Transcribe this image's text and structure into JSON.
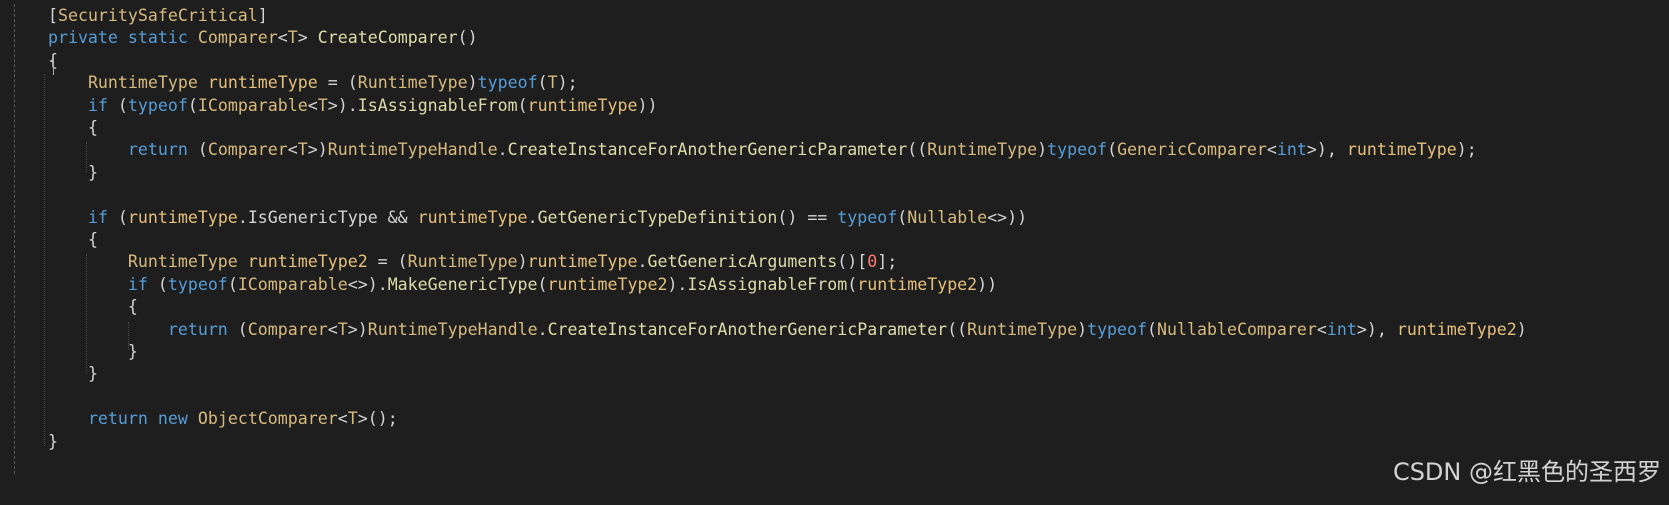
{
  "colors": {
    "background": "#1e1e1e",
    "default": "#d4d4d4",
    "keyword": "#569cd6",
    "type": "#d7ba7d",
    "method": "#dcdcaa",
    "variable": "#e6c07b",
    "number": "#ff7b72",
    "bracket": "#d4d4d4"
  },
  "code": {
    "lines": [
      [
        {
          "t": "    ",
          "c": "default"
        },
        {
          "t": "[",
          "c": "default"
        },
        {
          "t": "SecuritySafeCritical",
          "c": "type"
        },
        {
          "t": "]",
          "c": "default"
        }
      ],
      [
        {
          "t": "    ",
          "c": "default"
        },
        {
          "t": "private",
          "c": "keyword"
        },
        {
          "t": " ",
          "c": "default"
        },
        {
          "t": "static",
          "c": "keyword"
        },
        {
          "t": " ",
          "c": "default"
        },
        {
          "t": "Comparer",
          "c": "type"
        },
        {
          "t": "<",
          "c": "default"
        },
        {
          "t": "T",
          "c": "type"
        },
        {
          "t": "> ",
          "c": "default"
        },
        {
          "t": "CreateComparer",
          "c": "method"
        },
        {
          "t": "()",
          "c": "default"
        }
      ],
      [
        {
          "t": "    ",
          "c": "default"
        },
        {
          "t": "{",
          "c": "default"
        }
      ],
      [
        {
          "t": "        ",
          "c": "default"
        },
        {
          "t": "RuntimeType",
          "c": "type"
        },
        {
          "t": " ",
          "c": "default"
        },
        {
          "t": "runtimeType",
          "c": "variable"
        },
        {
          "t": " = (",
          "c": "default"
        },
        {
          "t": "RuntimeType",
          "c": "type"
        },
        {
          "t": ")",
          "c": "default"
        },
        {
          "t": "typeof",
          "c": "keyword"
        },
        {
          "t": "(",
          "c": "default"
        },
        {
          "t": "T",
          "c": "type"
        },
        {
          "t": ");",
          "c": "default"
        }
      ],
      [
        {
          "t": "        ",
          "c": "default"
        },
        {
          "t": "if",
          "c": "keyword"
        },
        {
          "t": " (",
          "c": "default"
        },
        {
          "t": "typeof",
          "c": "keyword"
        },
        {
          "t": "(",
          "c": "default"
        },
        {
          "t": "IComparable",
          "c": "type"
        },
        {
          "t": "<",
          "c": "default"
        },
        {
          "t": "T",
          "c": "type"
        },
        {
          "t": ">).",
          "c": "default"
        },
        {
          "t": "IsAssignableFrom",
          "c": "method"
        },
        {
          "t": "(",
          "c": "default"
        },
        {
          "t": "runtimeType",
          "c": "variable"
        },
        {
          "t": "))",
          "c": "default"
        }
      ],
      [
        {
          "t": "        ",
          "c": "default"
        },
        {
          "t": "{",
          "c": "default"
        }
      ],
      [
        {
          "t": "            ",
          "c": "default"
        },
        {
          "t": "return",
          "c": "keyword"
        },
        {
          "t": " (",
          "c": "default"
        },
        {
          "t": "Comparer",
          "c": "type"
        },
        {
          "t": "<",
          "c": "default"
        },
        {
          "t": "T",
          "c": "type"
        },
        {
          "t": ">)",
          "c": "default"
        },
        {
          "t": "RuntimeTypeHandle",
          "c": "type"
        },
        {
          "t": ".",
          "c": "default"
        },
        {
          "t": "CreateInstanceForAnotherGenericParameter",
          "c": "method"
        },
        {
          "t": "((",
          "c": "default"
        },
        {
          "t": "RuntimeType",
          "c": "type"
        },
        {
          "t": ")",
          "c": "default"
        },
        {
          "t": "typeof",
          "c": "keyword"
        },
        {
          "t": "(",
          "c": "default"
        },
        {
          "t": "GenericComparer",
          "c": "type"
        },
        {
          "t": "<",
          "c": "default"
        },
        {
          "t": "int",
          "c": "keyword"
        },
        {
          "t": ">), ",
          "c": "default"
        },
        {
          "t": "runtimeType",
          "c": "variable"
        },
        {
          "t": ");",
          "c": "default"
        }
      ],
      [
        {
          "t": "        ",
          "c": "default"
        },
        {
          "t": "}",
          "c": "default"
        }
      ],
      [],
      [
        {
          "t": "        ",
          "c": "default"
        },
        {
          "t": "if",
          "c": "keyword"
        },
        {
          "t": " (",
          "c": "default"
        },
        {
          "t": "runtimeType",
          "c": "variable"
        },
        {
          "t": ".",
          "c": "default"
        },
        {
          "t": "IsGenericType",
          "c": "default"
        },
        {
          "t": " && ",
          "c": "default"
        },
        {
          "t": "runtimeType",
          "c": "variable"
        },
        {
          "t": ".",
          "c": "default"
        },
        {
          "t": "GetGenericTypeDefinition",
          "c": "method"
        },
        {
          "t": "() == ",
          "c": "default"
        },
        {
          "t": "typeof",
          "c": "keyword"
        },
        {
          "t": "(",
          "c": "default"
        },
        {
          "t": "Nullable",
          "c": "type"
        },
        {
          "t": "<>))",
          "c": "default"
        }
      ],
      [
        {
          "t": "        ",
          "c": "default"
        },
        {
          "t": "{",
          "c": "default"
        }
      ],
      [
        {
          "t": "            ",
          "c": "default"
        },
        {
          "t": "RuntimeType",
          "c": "type"
        },
        {
          "t": " ",
          "c": "default"
        },
        {
          "t": "runtimeType2",
          "c": "variable"
        },
        {
          "t": " = (",
          "c": "default"
        },
        {
          "t": "RuntimeType",
          "c": "type"
        },
        {
          "t": ")",
          "c": "default"
        },
        {
          "t": "runtimeType",
          "c": "variable"
        },
        {
          "t": ".",
          "c": "default"
        },
        {
          "t": "GetGenericArguments",
          "c": "method"
        },
        {
          "t": "()[",
          "c": "default"
        },
        {
          "t": "0",
          "c": "number"
        },
        {
          "t": "];",
          "c": "default"
        }
      ],
      [
        {
          "t": "            ",
          "c": "default"
        },
        {
          "t": "if",
          "c": "keyword"
        },
        {
          "t": " (",
          "c": "default"
        },
        {
          "t": "typeof",
          "c": "keyword"
        },
        {
          "t": "(",
          "c": "default"
        },
        {
          "t": "IComparable",
          "c": "type"
        },
        {
          "t": "<>).",
          "c": "default"
        },
        {
          "t": "MakeGenericType",
          "c": "method"
        },
        {
          "t": "(",
          "c": "default"
        },
        {
          "t": "runtimeType2",
          "c": "variable"
        },
        {
          "t": ").",
          "c": "default"
        },
        {
          "t": "IsAssignableFrom",
          "c": "method"
        },
        {
          "t": "(",
          "c": "default"
        },
        {
          "t": "runtimeType2",
          "c": "variable"
        },
        {
          "t": "))",
          "c": "default"
        }
      ],
      [
        {
          "t": "            ",
          "c": "default"
        },
        {
          "t": "{",
          "c": "default"
        }
      ],
      [
        {
          "t": "                ",
          "c": "default"
        },
        {
          "t": "return",
          "c": "keyword"
        },
        {
          "t": " (",
          "c": "default"
        },
        {
          "t": "Comparer",
          "c": "type"
        },
        {
          "t": "<",
          "c": "default"
        },
        {
          "t": "T",
          "c": "type"
        },
        {
          "t": ">)",
          "c": "default"
        },
        {
          "t": "RuntimeTypeHandle",
          "c": "type"
        },
        {
          "t": ".",
          "c": "default"
        },
        {
          "t": "CreateInstanceForAnotherGenericParameter",
          "c": "method"
        },
        {
          "t": "((",
          "c": "default"
        },
        {
          "t": "RuntimeType",
          "c": "type"
        },
        {
          "t": ")",
          "c": "default"
        },
        {
          "t": "typeof",
          "c": "keyword"
        },
        {
          "t": "(",
          "c": "default"
        },
        {
          "t": "NullableComparer",
          "c": "type"
        },
        {
          "t": "<",
          "c": "default"
        },
        {
          "t": "int",
          "c": "keyword"
        },
        {
          "t": ">), ",
          "c": "default"
        },
        {
          "t": "runtimeType2",
          "c": "variable"
        },
        {
          "t": ")",
          "c": "default"
        }
      ],
      [
        {
          "t": "            ",
          "c": "default"
        },
        {
          "t": "}",
          "c": "default"
        }
      ],
      [
        {
          "t": "        ",
          "c": "default"
        },
        {
          "t": "}",
          "c": "default"
        }
      ],
      [],
      [
        {
          "t": "        ",
          "c": "default"
        },
        {
          "t": "return",
          "c": "keyword"
        },
        {
          "t": " ",
          "c": "default"
        },
        {
          "t": "new",
          "c": "keyword"
        },
        {
          "t": " ",
          "c": "default"
        },
        {
          "t": "ObjectComparer",
          "c": "type"
        },
        {
          "t": "<",
          "c": "default"
        },
        {
          "t": "T",
          "c": "type"
        },
        {
          "t": ">();",
          "c": "default"
        }
      ],
      [
        {
          "t": "    ",
          "c": "default"
        },
        {
          "t": "}",
          "c": "default"
        }
      ]
    ]
  },
  "watermark": "CSDN @红黑色的圣西罗"
}
